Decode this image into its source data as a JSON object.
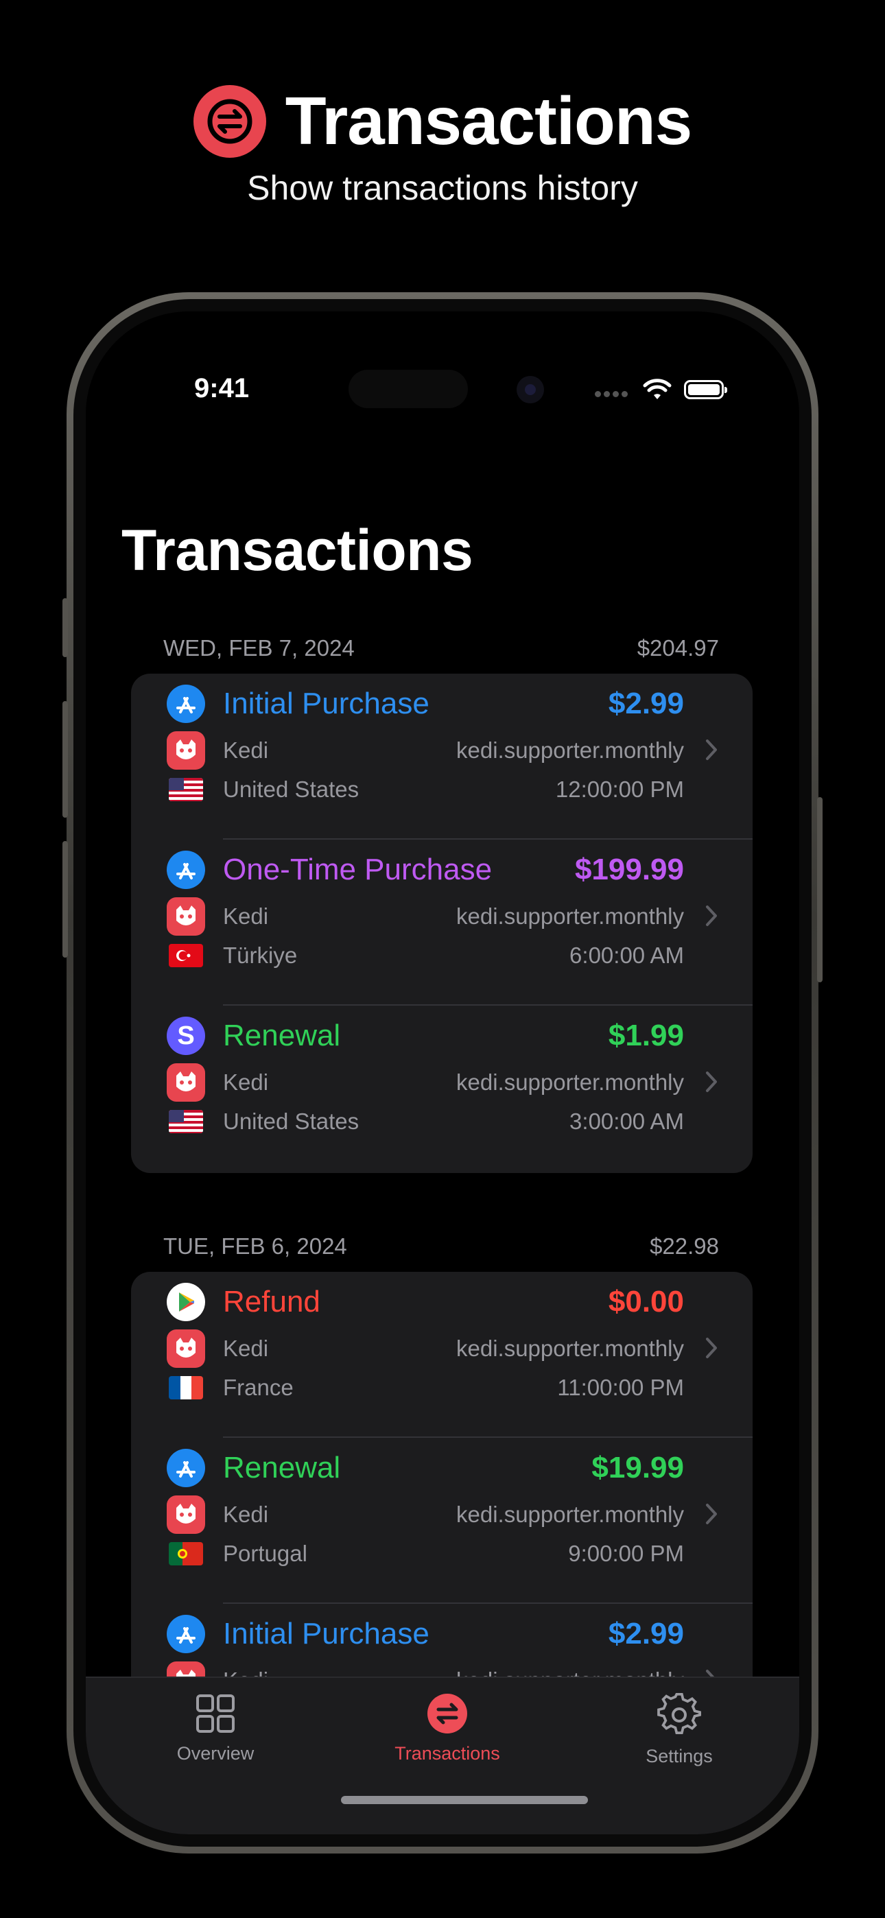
{
  "hero": {
    "title": "Transactions",
    "subtitle": "Show transactions history"
  },
  "status_bar": {
    "time": "9:41"
  },
  "page_title": "Transactions",
  "accent_color": "#ee4d57",
  "sections": [
    {
      "date": "WED, FEB 7, 2024",
      "total": "$204.97",
      "rows": [
        {
          "type": "Initial Purchase",
          "type_color": "#2e8ff0",
          "price": "$2.99",
          "store_icon": "app-store-icon",
          "app": "Kedi",
          "product": "kedi.supporter.monthly",
          "country": "United States",
          "flag": "us-flag-icon",
          "time": "12:00:00 PM"
        },
        {
          "type": "One-Time Purchase",
          "type_color": "#bf5af2",
          "price": "$199.99",
          "store_icon": "app-store-icon",
          "app": "Kedi",
          "product": "kedi.supporter.monthly",
          "country": "Türkiye",
          "flag": "tr-flag-icon",
          "time": "6:00:00 AM"
        },
        {
          "type": "Renewal",
          "type_color": "#30d158",
          "price": "$1.99",
          "store_icon": "stripe-icon",
          "app": "Kedi",
          "product": "kedi.supporter.monthly",
          "country": "United States",
          "flag": "us-flag-icon",
          "time": "3:00:00 AM"
        }
      ]
    },
    {
      "date": "TUE, FEB 6, 2024",
      "total": "$22.98",
      "rows": [
        {
          "type": "Refund",
          "type_color": "#ff453a",
          "price": "$0.00",
          "store_icon": "google-play-icon",
          "app": "Kedi",
          "product": "kedi.supporter.monthly",
          "country": "France",
          "flag": "fr-flag-icon",
          "time": "11:00:00 PM"
        },
        {
          "type": "Renewal",
          "type_color": "#30d158",
          "price": "$19.99",
          "store_icon": "app-store-icon",
          "app": "Kedi",
          "product": "kedi.supporter.monthly",
          "country": "Portugal",
          "flag": "pt-flag-icon",
          "time": "9:00:00 PM"
        },
        {
          "type": "Initial Purchase",
          "type_color": "#2e8ff0",
          "price": "$2.99",
          "store_icon": "app-store-icon",
          "app": "Kedi",
          "product": "kedi.supporter.monthly"
        }
      ]
    }
  ],
  "tabs": [
    {
      "label": "Overview",
      "icon": "grid-icon",
      "active": false
    },
    {
      "label": "Transactions",
      "icon": "transactions-icon",
      "active": true
    },
    {
      "label": "Settings",
      "icon": "gear-icon",
      "active": false
    }
  ]
}
